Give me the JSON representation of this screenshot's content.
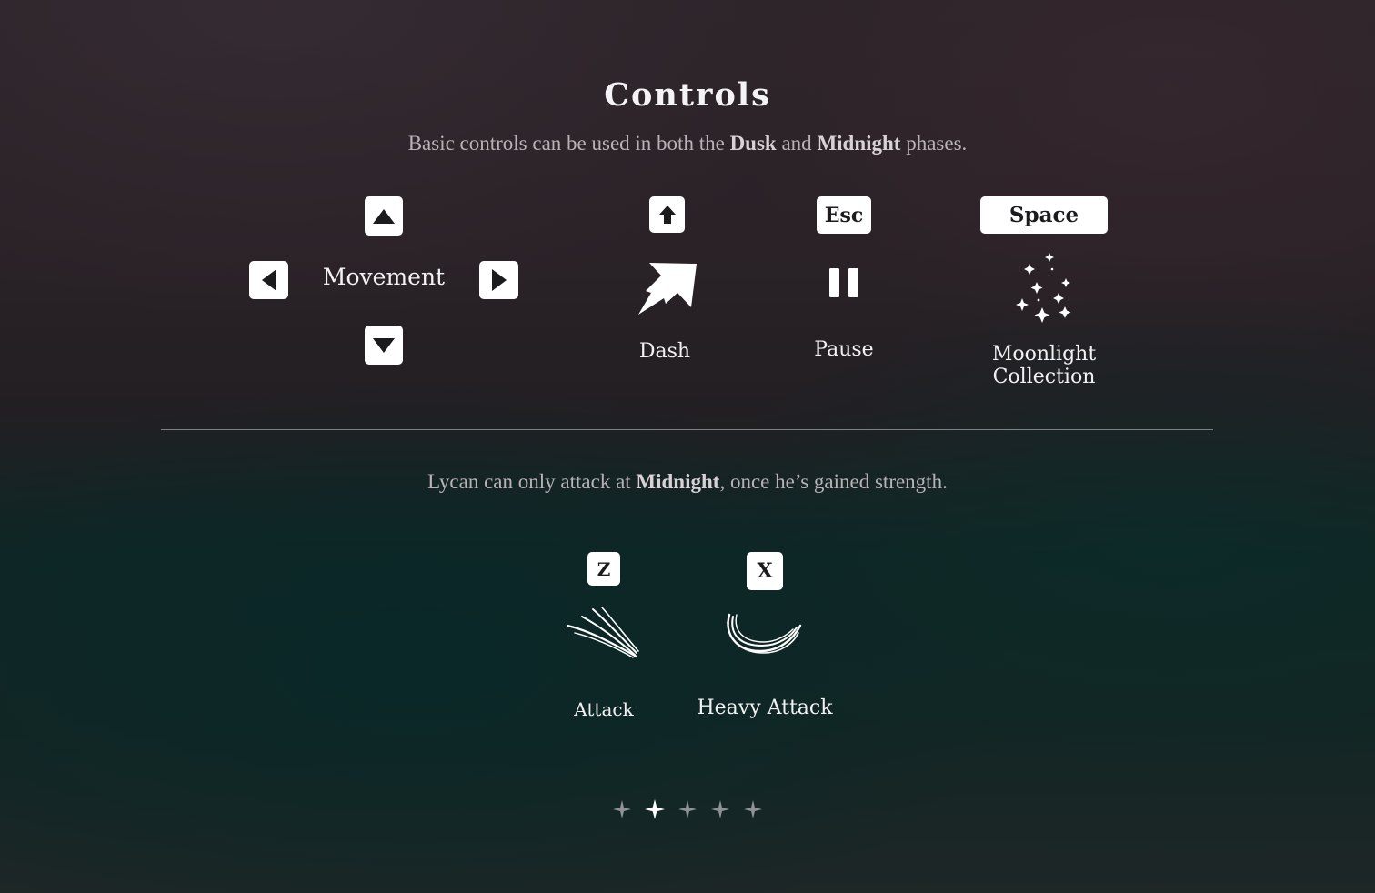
{
  "header": {
    "title": "Controls",
    "subtitle_parts": [
      "Basic controls can be used in both the ",
      "Dusk",
      " and ",
      "Midnight",
      " phases."
    ]
  },
  "basic": {
    "movement_label": "Movement",
    "dash": {
      "key_icon": "shift-arrow-up-icon",
      "icon": "dash-arrow-icon",
      "label": "Dash"
    },
    "pause": {
      "key": "Esc",
      "icon": "pause-icon",
      "label": "Pause"
    },
    "moonlight": {
      "key": "Space",
      "icon": "sparkles-icon",
      "label_line1": "Moonlight",
      "label_line2": "Collection"
    }
  },
  "midnight": {
    "note_parts": [
      "Lycan can only attack at ",
      "Midnight",
      ", once he’s gained strength."
    ],
    "attack": {
      "key": "Z",
      "icon": "claw-slash-icon",
      "label": "Attack"
    },
    "heavy_attack": {
      "key": "X",
      "icon": "heavy-slash-icon",
      "label": "Heavy Attack"
    }
  },
  "pagination": {
    "current_page": 2,
    "total_pages": 5
  },
  "colors": {
    "text": "#f2f0f2",
    "subtext": "#b9b3b8",
    "key_bg": "#ffffff",
    "key_text": "#1b1a1d",
    "dot_active": "#ffffff",
    "dot_inactive": "#8f9395"
  }
}
